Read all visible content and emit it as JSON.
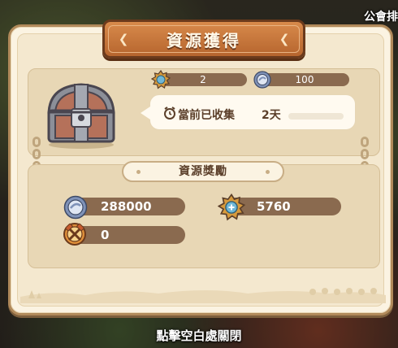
{
  "background": {
    "guild_label": "公會排"
  },
  "dialog": {
    "title": "資源獲得",
    "top_resources": [
      {
        "icon": "gear-star-icon",
        "value": "2"
      },
      {
        "icon": "silver-coin-icon",
        "value": "100"
      }
    ],
    "collected": {
      "label": "當前已收集",
      "value": "2天",
      "icon": "alarm-clock-icon"
    },
    "section_title": "資源獎勵",
    "rewards": [
      {
        "icon": "silver-coin-icon",
        "value": "288000"
      },
      {
        "icon": "gear-star-icon",
        "value": "5760"
      },
      {
        "icon": "crossed-hammer-badge-icon",
        "value": "0"
      }
    ]
  },
  "footer": {
    "hint": "點擊空白處關閉"
  },
  "colors": {
    "panel_bg": "#fbf3e2",
    "panel_border": "#b18a5b",
    "banner": "#c7723a",
    "pill": "#8a6a4f",
    "text_dark": "#5b3f2a"
  }
}
